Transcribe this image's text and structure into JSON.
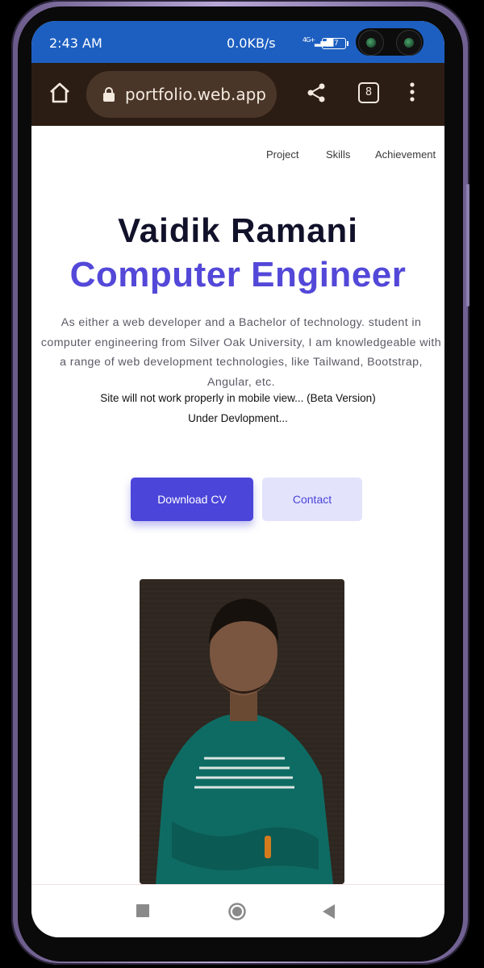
{
  "status": {
    "time": "2:43 AM",
    "network_speed": "0.0KB/s",
    "signal": "4G+",
    "battery": "87"
  },
  "browser": {
    "url": "portfolio.web.app",
    "tab_count": "8"
  },
  "nav": {
    "items": [
      "Project",
      "Skills",
      "Achievement"
    ]
  },
  "hero": {
    "name": "Vaidik Ramani",
    "role": "Computer Engineer",
    "description": "As either a web developer and a Bachelor of technology. student in computer engineering from Silver Oak University, I am knowledgeable with a range of web development technologies, like Tailwand, Bootstrap, Angular, etc.",
    "notice": "Site will not work properly in mobile view... (Beta Version)",
    "status_note": "Under Devlopment..."
  },
  "buttons": {
    "download_cv": "Download CV",
    "contact": "Contact"
  },
  "colors": {
    "accent": "#4b45da",
    "status_bar": "#1d5fc1",
    "url_bar": "#2c1d14"
  }
}
